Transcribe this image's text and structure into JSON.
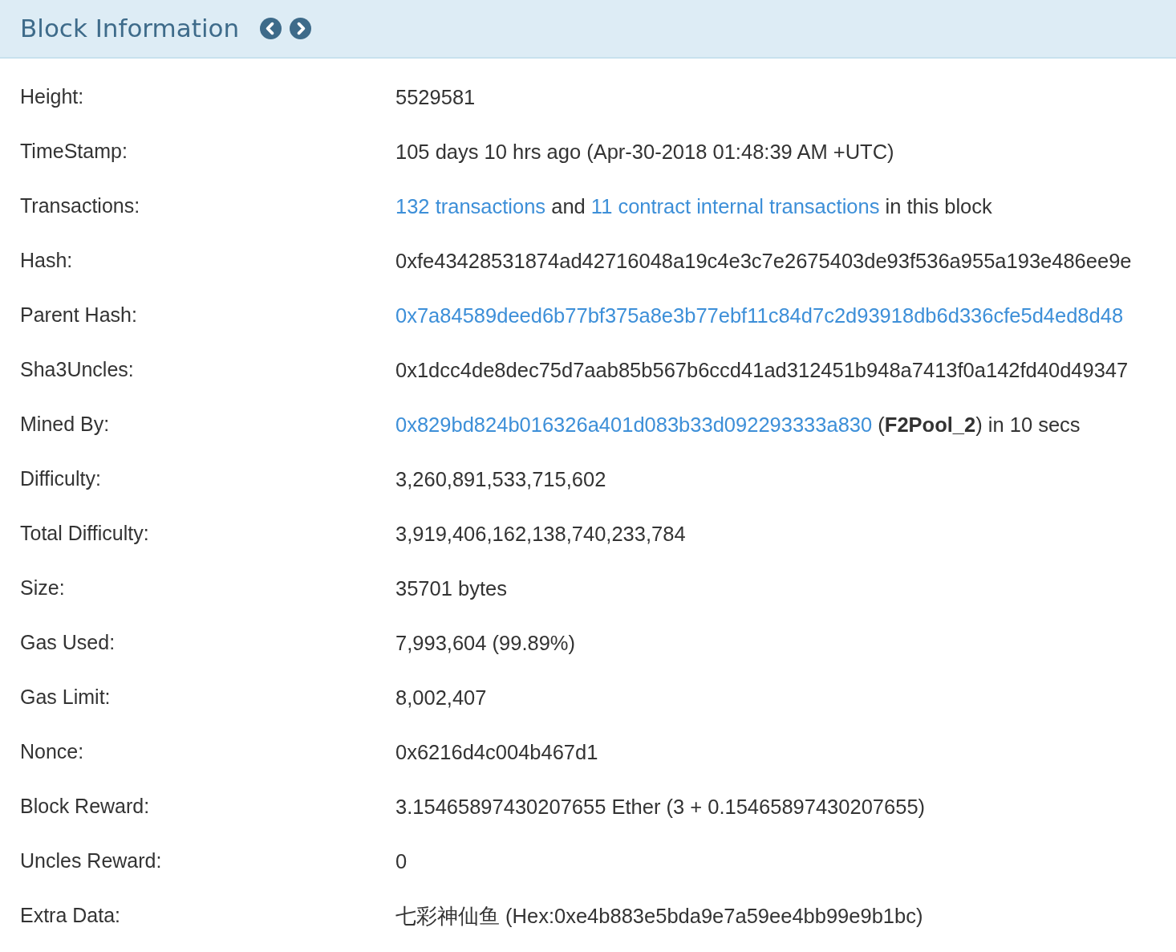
{
  "header": {
    "title": "Block Information"
  },
  "rows": [
    {
      "label": "Height:",
      "value": [
        {
          "kind": "text",
          "text": "5529581"
        }
      ]
    },
    {
      "label": "TimeStamp:",
      "value": [
        {
          "kind": "text",
          "text": "105 days 10 hrs ago (Apr-30-2018 01:48:39 AM +UTC)"
        }
      ]
    },
    {
      "label": "Transactions:",
      "value": [
        {
          "kind": "link",
          "text": "132 transactions"
        },
        {
          "kind": "text",
          "text": "and"
        },
        {
          "kind": "link",
          "text": "11 contract internal transactions"
        },
        {
          "kind": "text",
          "text": "in this block"
        }
      ]
    },
    {
      "label": "Hash:",
      "value": [
        {
          "kind": "text",
          "text": "0xfe43428531874ad42716048a19c4e3c7e2675403de93f536a955a193e486ee9e"
        }
      ]
    },
    {
      "label": "Parent Hash:",
      "value": [
        {
          "kind": "link",
          "text": "0x7a84589deed6b77bf375a8e3b77ebf11c84d7c2d93918db6d336cfe5d4ed8d48"
        }
      ]
    },
    {
      "label": "Sha3Uncles:",
      "value": [
        {
          "kind": "text",
          "text": "0x1dcc4de8dec75d7aab85b567b6ccd41ad312451b948a7413f0a142fd40d49347"
        }
      ]
    },
    {
      "label": "Mined By:",
      "value": [
        {
          "kind": "link",
          "text": "0x829bd824b016326a401d083b33d092293333a830"
        },
        {
          "kind": "text",
          "text": "(**F2Pool_2**) in 10 secs"
        }
      ]
    },
    {
      "label": "Difficulty:",
      "value": [
        {
          "kind": "text",
          "text": "3,260,891,533,715,602"
        }
      ]
    },
    {
      "label": "Total Difficulty:",
      "value": [
        {
          "kind": "text",
          "text": "3,919,406,162,138,740,233,784"
        }
      ]
    },
    {
      "label": "Size:",
      "value": [
        {
          "kind": "text",
          "text": "35701 bytes"
        }
      ]
    },
    {
      "label": "Gas Used:",
      "value": [
        {
          "kind": "text",
          "text": "7,993,604 (99.89%)"
        }
      ]
    },
    {
      "label": "Gas Limit:",
      "value": [
        {
          "kind": "text",
          "text": "8,002,407"
        }
      ]
    },
    {
      "label": "Nonce:",
      "value": [
        {
          "kind": "text",
          "text": "0x6216d4c004b467d1"
        }
      ]
    },
    {
      "label": "Block Reward:",
      "value": [
        {
          "kind": "text",
          "text": "3.15465897430207655 Ether (3 + 0.15465897430207655)"
        }
      ]
    },
    {
      "label": "Uncles Reward:",
      "value": [
        {
          "kind": "text",
          "text": "0"
        }
      ]
    },
    {
      "label": "Extra Data:",
      "value": [
        {
          "kind": "text",
          "text": "七彩神仙鱼 (Hex:0xe4b883e5bda9e7a59ee4bb99e9b1bc)"
        }
      ]
    }
  ]
}
